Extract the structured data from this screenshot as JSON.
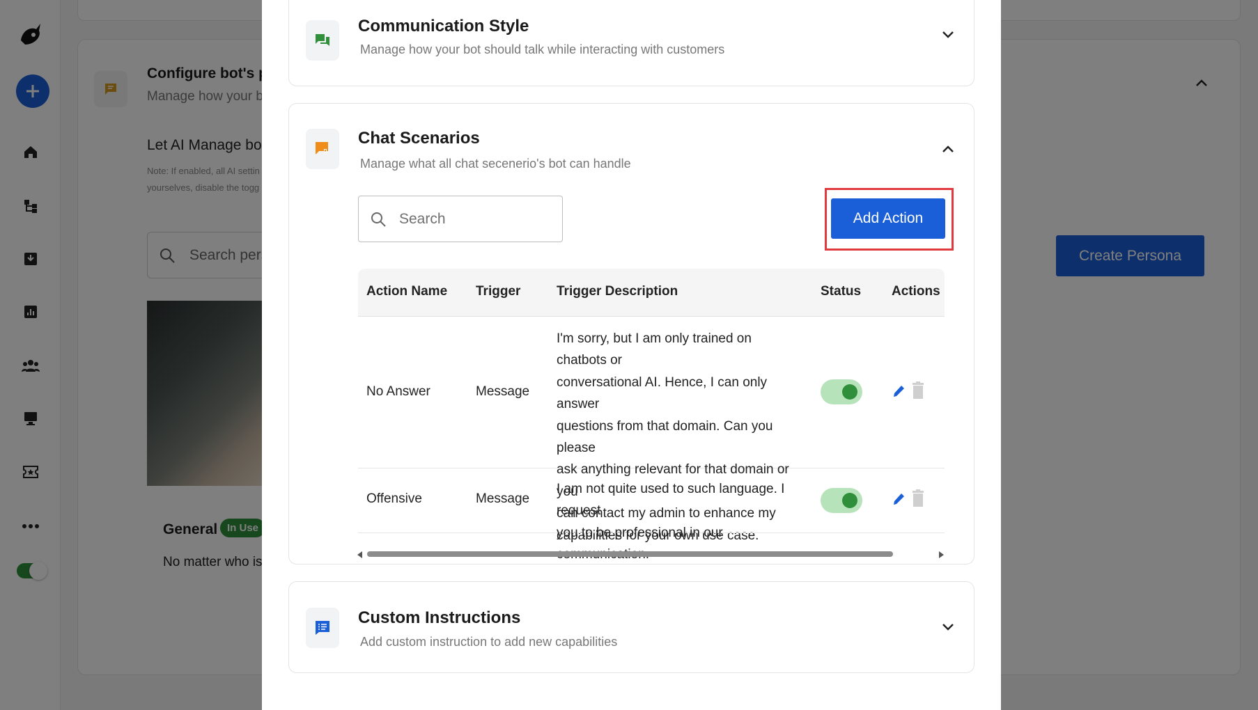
{
  "background": {
    "persona": {
      "title": "Configure bot's pe",
      "subtitle": "Manage how your bot",
      "let_ai_label": "Let AI Manage bot's",
      "note": "Note: If enabled, all AI settin yourselves, disable the togg",
      "search_placeholder": "Search perso",
      "create_button": "Create Persona",
      "card_name": "General",
      "card_badge": "In Use",
      "card_desc": "No matter who is t"
    },
    "sidebar": {
      "icons": [
        "logo-icon",
        "plus-icon",
        "home-icon",
        "flow-icon",
        "inbox-icon",
        "analytics-icon",
        "users-icon",
        "monitor-icon",
        "ticket-icon",
        "more-icon"
      ]
    }
  },
  "modal": {
    "communication": {
      "title": "Communication Style",
      "subtitle": "Manage how your bot should talk while interacting with customers"
    },
    "chat_scenarios": {
      "title": "Chat Scenarios",
      "subtitle": "Manage what all chat secenerio's bot can handle",
      "search_placeholder": "Search",
      "add_action_label": "Add Action",
      "table": {
        "headers": [
          "Action Name",
          "Trigger",
          "Trigger Description",
          "Status",
          "Actions"
        ],
        "rows": [
          {
            "name": "No Answer",
            "trigger": "Message",
            "description_lines": [
              "I'm sorry, but I am only trained on chatbots or",
              "conversational AI. Hence, I can only answer",
              "questions from that domain. Can you please",
              "ask anything relevant for that domain or you",
              "can contact my admin to enhance my",
              "capabilities for your own use case."
            ],
            "status_on": true
          },
          {
            "name": "Offensive",
            "trigger": "Message",
            "description_lines": [
              "I am not quite used to such language. I request",
              "you to be professional in our communication."
            ],
            "status_on": true
          }
        ]
      }
    },
    "custom_instructions": {
      "title": "Custom Instructions",
      "subtitle": "Add custom instruction to add new capabilities"
    }
  },
  "colors": {
    "primary": "#1a5ed8",
    "highlight": "#e0393e",
    "success": "#2f8f3a",
    "toggle_track": "#b6e3ba"
  }
}
